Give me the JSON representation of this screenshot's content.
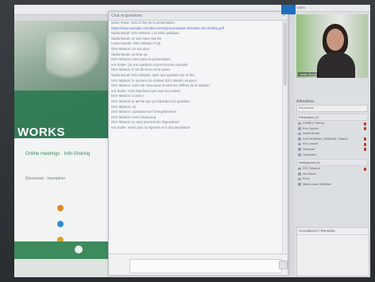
{
  "chat": {
    "title": "Chat et questions",
    "messages": [
      "Mario Rossi: Voici le lien de la présentation :",
      "https://www.example.com/documents/presentation-networks-info-sharing.pdf",
      "Nadia Burati: DSV Mission 1 la vidéo publique",
      "Nadia Burati: Je suis sans mot lire",
      "Laura Sander: DSV Mission FAQ!",
      "DSV Mission: en voir plus",
      "Nadia Burati: au bout qu",
      "DSV Mission: merci pour la présentation",
      "eric bader: j'ai une question concernant les exposés",
      "DSV Mission: il me dit merci de le poser",
      "Nadia Burati: DSV Mission, avec une question sur le site",
      "DSV Mission: le moment de réaliser DSV Mission toujours",
      "DSV Mission: merci de nous avoir montré les chiffres de la session",
      "eric bader: c'est important que nous les votions",
      "DSV Mission: à venir !",
      "DSV Mission: je pense que ça répondra à la question",
      "DSV Mission: ok",
      "DSV Mission: questions sur l'enregistrement",
      "DSV Mission: merci beaucoup",
      "DSV Mission: je vous enverrai les diapositives",
      "eric bader: merci pour la réponse et la documentation"
    ],
    "input_placeholder": ""
  },
  "slide": {
    "title": "WORKS",
    "subtitle": "Online meetings · Info-Sharing",
    "body": "Document · Inscription",
    "footer": ""
  },
  "right": {
    "header": "Video",
    "video_name": "Nadia Burati",
    "attendees_title": "Attendees",
    "search_label": "Rechercher",
    "group1": "Presenters (7)",
    "group1_members": [
      {
        "name": "CHINEL Fabrice",
        "mic": true
      },
      {
        "name": "Eric Gavrila",
        "mic": true
      },
      {
        "name": "Nadia Burati",
        "mic": false
      },
      {
        "name": "LACHEMANN, LINDEAN, Fabrice",
        "mic": true
      },
      {
        "name": "Eric Lazard",
        "mic": true
      },
      {
        "name": "Nhieman",
        "mic": true
      },
      {
        "name": "Sébastien",
        "mic": false
      }
    ],
    "group2": "Participants (4)",
    "group2_members": [
      {
        "name": "DSV Mission",
        "mic": true
      },
      {
        "name": "eric bader",
        "mic": false
      },
      {
        "name": "Roxy",
        "mic": false
      },
      {
        "name": "Marie-Laure Martinon",
        "mic": false
      }
    ],
    "notes_title": "Annotations / Remarks"
  },
  "colors": {
    "brand_green": "#2f7a54",
    "accent_blue": "#1e6fbf",
    "mic_red": "#c0392b"
  }
}
